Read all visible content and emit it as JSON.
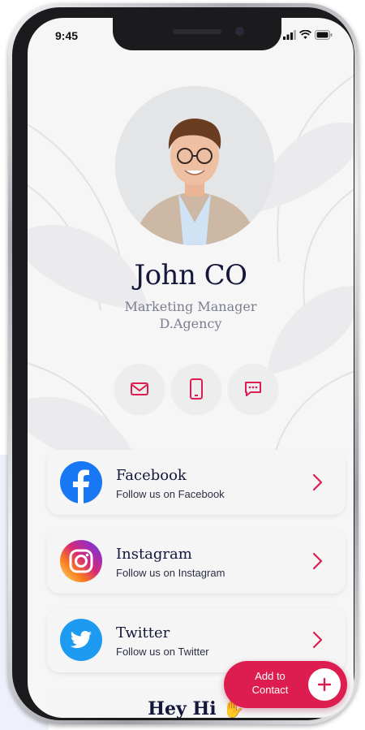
{
  "status_bar": {
    "time": "9:45"
  },
  "profile": {
    "name": "John CO",
    "title": "Marketing Manager",
    "company": "D.Agency"
  },
  "actions": [
    {
      "icon": "mail-icon"
    },
    {
      "icon": "phone-icon"
    },
    {
      "icon": "chat-icon"
    }
  ],
  "social": [
    {
      "title": "Facebook",
      "subtitle": "Follow us on Facebook",
      "icon": "facebook-icon"
    },
    {
      "title": "Instagram",
      "subtitle": "Follow us on Instagram",
      "icon": "instagram-icon"
    },
    {
      "title": "Twitter",
      "subtitle": "Follow us on Twitter",
      "icon": "twitter-icon"
    }
  ],
  "greeting": "Hey Hi",
  "add_contact": {
    "line1": "Add to",
    "line2": "Contact"
  },
  "colors": {
    "accent": "#dd1d4f",
    "name_text": "#15173a",
    "subtitle_text": "#7b7e8e",
    "facebook": "#1877f2",
    "twitter": "#1d9bf0"
  }
}
